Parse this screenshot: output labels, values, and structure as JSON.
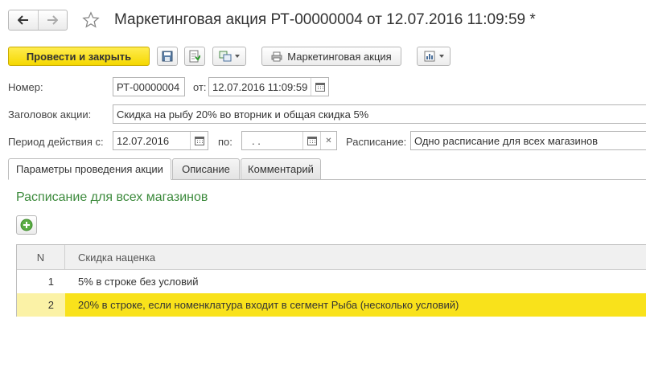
{
  "window": {
    "title": "Маркетинговая акция РТ-00000004 от 12.07.2016 11:09:59 *"
  },
  "toolbar": {
    "post_close_label": "Провести и закрыть",
    "print_label": "Маркетинговая акция"
  },
  "form": {
    "number_label": "Номер:",
    "number_value": "РТ-00000004",
    "date_label": "от:",
    "date_value": "12.07.2016 11:09:59",
    "heading_label": "Заголовок акции:",
    "heading_value": "Скидка на рыбу 20% во вторник и общая скидка 5%",
    "period_label": "Период действия с:",
    "period_from": "12.07.2016",
    "period_to_label": "по:",
    "period_to": " .  .",
    "schedule_label": "Расписание:",
    "schedule_value": "Одно расписание для всех магазинов"
  },
  "tabs": [
    {
      "label": "Параметры проведения акции",
      "active": true
    },
    {
      "label": "Описание",
      "active": false
    },
    {
      "label": "Комментарий",
      "active": false
    }
  ],
  "section": {
    "title": "Расписание для всех магазинов"
  },
  "table": {
    "columns": [
      "N",
      "Скидка наценка"
    ],
    "rows": [
      {
        "n": "1",
        "discount": "5% в строке без условий",
        "selected": false
      },
      {
        "n": "2",
        "discount": "20% в строке, если номенклатура входит в сегмент Рыба (несколько условий)",
        "selected": true
      }
    ]
  },
  "colors": {
    "primary_button": "#f5d800",
    "selected_row": "#f9e21b",
    "section_title": "#3c8a3c"
  }
}
